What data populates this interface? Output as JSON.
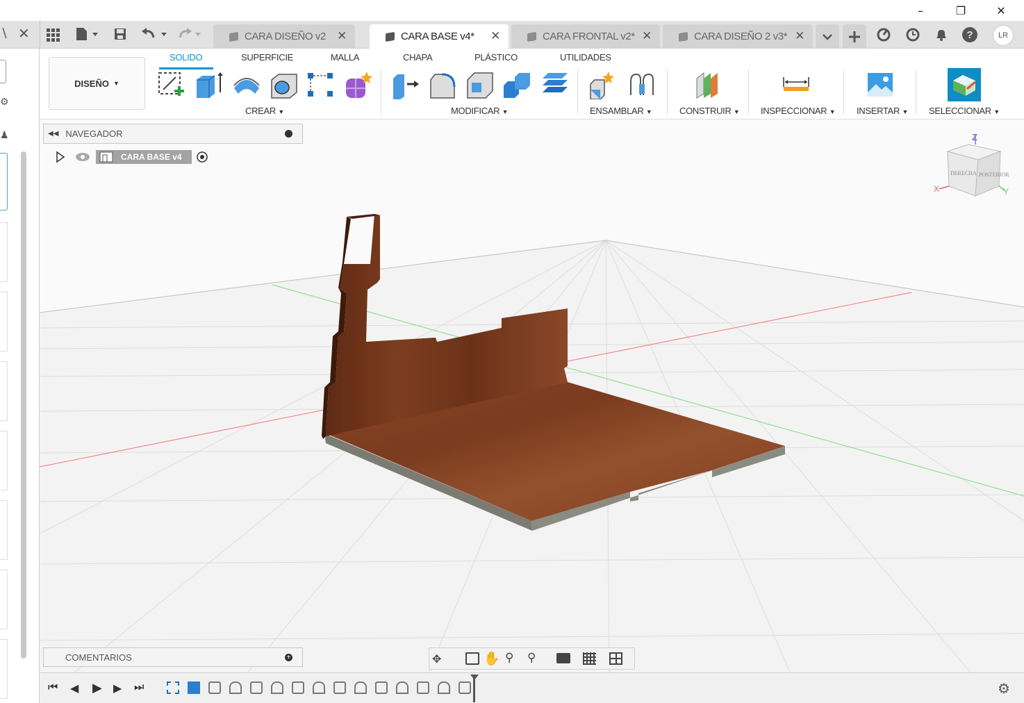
{
  "tabs": [
    {
      "label": "CARA DISEÑO v2",
      "active": false
    },
    {
      "label": "CARA BASE v4*",
      "active": true
    },
    {
      "label": "CARA FRONTAL v2*",
      "active": false
    },
    {
      "label": "CARA DISEÑO 2 v3*",
      "active": false
    }
  ],
  "user": {
    "initials": "LR"
  },
  "ribbon": {
    "workspace": "DISEÑO",
    "tabs": [
      "SOLIDO",
      "SUPERFICIE",
      "MALLA",
      "CHAPA",
      "PLÁSTICO",
      "UTILIDADES"
    ],
    "groups": {
      "create": "CREAR",
      "modify": "MODIFICAR",
      "assemble": "ENSAMBLAR",
      "construct": "CONSTRUIR",
      "inspect": "INSPECCIONAR",
      "insert": "INSERTAR",
      "select": "SELECCIONAR"
    }
  },
  "navigator": {
    "title": "NAVEGADOR",
    "root_node": "CARA BASE v4"
  },
  "comments": {
    "title": "COMENTARIOS"
  },
  "viewcube": {
    "top_axis": "Z",
    "x_axis": "X",
    "y_axis": "Y",
    "face_right": "DERECHA",
    "face_back": "POSTERIOR"
  },
  "colors": {
    "accent": "#0696d7",
    "wood": "#7a3a1f",
    "grid_x": "#f08a8a",
    "grid_y": "#8ee28e"
  },
  "icons": {
    "apps": "grid-icon",
    "file": "file-icon",
    "save": "save-icon",
    "undo": "undo-icon",
    "redo": "redo-icon",
    "extensions": "extensions-icon",
    "history": "clock-icon",
    "notifications": "bell-icon",
    "help": "help-icon",
    "settings": "gear-icon"
  }
}
